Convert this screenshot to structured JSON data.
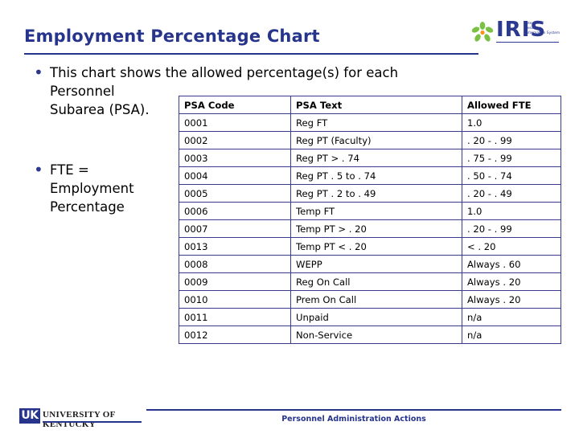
{
  "slide": {
    "title": "Employment Percentage Chart",
    "bullets": [
      {
        "line1": "This chart shows the allowed percentage(s) for each",
        "line2": "Personnel",
        "line3": "Subarea (PSA)."
      },
      {
        "line1": "FTE =",
        "line2": "Employment",
        "line3": "Percentage"
      }
    ],
    "table": {
      "headers": [
        "PSA Code",
        "PSA Text",
        "Allowed FTE"
      ],
      "rows": [
        [
          "0001",
          "Reg FT",
          "1.0"
        ],
        [
          "0002",
          "Reg PT (Faculty)",
          ". 20 - . 99"
        ],
        [
          "0003",
          "Reg PT > . 74",
          ". 75 - . 99"
        ],
        [
          "0004",
          "Reg PT . 5 to . 74",
          ". 50 - . 74"
        ],
        [
          "0005",
          "Reg PT . 2 to . 49",
          ". 20 - . 49"
        ],
        [
          "0006",
          "Temp FT",
          "1.0"
        ],
        [
          "0007",
          "Temp PT > . 20",
          ". 20 - . 99"
        ],
        [
          "0013",
          "Temp PT < . 20",
          " < . 20"
        ],
        [
          "0008",
          "WEPP",
          "Always . 60"
        ],
        [
          "0009",
          "Reg On Call",
          "Always . 20"
        ],
        [
          "0010",
          "Prem On Call",
          "Always . 20"
        ],
        [
          "0011",
          "Unpaid",
          "n/a"
        ],
        [
          "0012",
          "Non-Service",
          "n/a"
        ]
      ]
    },
    "footer": {
      "text": "Personnel Administration Actions"
    },
    "logos": {
      "iris_word": "IRIS",
      "iris_sub": "Integrated Resource Information System",
      "uk_mark": "UK",
      "uk_name": "UNIVERSITY OF KENTUCKY"
    },
    "colors": {
      "brand_blue": "#26348c",
      "table_border": "#3a3a8c"
    }
  }
}
